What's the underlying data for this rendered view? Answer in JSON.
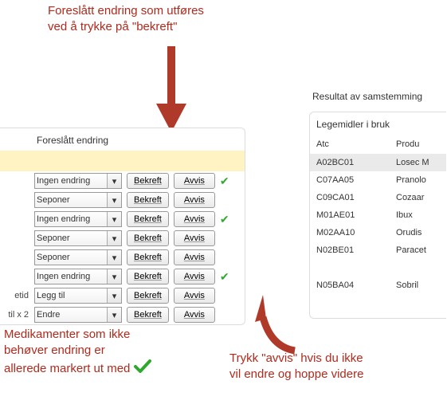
{
  "annotations": {
    "top_line1": "Foreslått endring som utføres",
    "top_line2": "ved  å trykke på \"bekreft\"",
    "bottom_left_line1": "Medikamenter som ikke",
    "bottom_left_line2": "behøver endring er",
    "bottom_left_line3": "allerede markert ut  med",
    "bottom_right_line1": "Trykk \"avvis\" hvis du ikke",
    "bottom_right_line2": "vil endre og hoppe videre"
  },
  "left": {
    "header": "Foreslått endring",
    "btn_confirm": "Bekreft",
    "btn_reject": "Avvis",
    "stub1": "etid",
    "stub2": "til x 2",
    "rows": [
      {
        "value": "Ingen endring",
        "checked": true,
        "stub": ""
      },
      {
        "value": "Seponer",
        "checked": false,
        "stub": ""
      },
      {
        "value": "Ingen endring",
        "checked": true,
        "stub": ""
      },
      {
        "value": "Seponer",
        "checked": false,
        "stub": ""
      },
      {
        "value": "Seponer",
        "checked": false,
        "stub": ""
      },
      {
        "value": "Ingen endring",
        "checked": true,
        "stub": ""
      },
      {
        "value": "Legg til",
        "checked": false,
        "stub": "etid"
      },
      {
        "value": "Endre",
        "checked": false,
        "stub": "til x 2"
      }
    ]
  },
  "right": {
    "title": "Resultat av samstemming",
    "section": "Legemidler i bruk",
    "col1": "Atc",
    "col2": "Produ",
    "rows": [
      {
        "atc": "A02BC01",
        "prod": "Losec M",
        "hl": true
      },
      {
        "atc": "C07AA05",
        "prod": "Pranolo",
        "hl": false
      },
      {
        "atc": "C09CA01",
        "prod": "Cozaar",
        "hl": false
      },
      {
        "atc": "M01AE01",
        "prod": "Ibux",
        "hl": false
      },
      {
        "atc": "M02AA10",
        "prod": "Orudis",
        "hl": false
      },
      {
        "atc": "N02BE01",
        "prod": "Paracet",
        "hl": false
      },
      {
        "atc": "",
        "prod": "",
        "hl": false
      },
      {
        "atc": "N05BA04",
        "prod": "Sobril",
        "hl": false
      }
    ]
  }
}
